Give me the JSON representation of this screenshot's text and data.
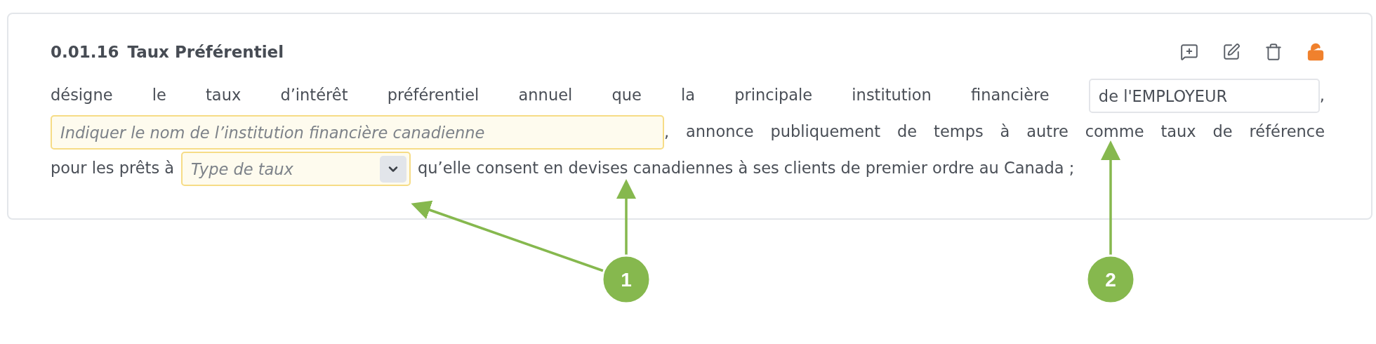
{
  "clause": {
    "number": "0.01.16",
    "title": "Taux Préférentiel",
    "actions": [
      {
        "kind": "comment"
      },
      {
        "kind": "edit"
      },
      {
        "kind": "delete"
      },
      {
        "kind": "unlock"
      }
    ],
    "lines": [
      [
        {
          "kind": "text",
          "text": "désigne le taux d’intérêt préférentiel annuel que la principale institution financière"
        },
        {
          "kind": "input",
          "value": "de l'EMPLOYEUR"
        },
        {
          "kind": "text",
          "text": ","
        }
      ],
      [
        {
          "kind": "input",
          "placeholder": "Indiquer le nom de l’institution financière canadienne"
        },
        {
          "kind": "text",
          "text": ", annonce publiquement de temps à autre comme taux de référence"
        }
      ],
      [
        {
          "kind": "text",
          "text": "pour les prêts à"
        },
        {
          "kind": "select",
          "placeholder": "Type de taux"
        },
        {
          "kind": "text",
          "text": "qu’elle consent en devises canadiennes à ses clients de premier ordre au Canada ;"
        }
      ]
    ]
  },
  "callouts": [
    {
      "label": "1"
    },
    {
      "label": "2"
    }
  ]
}
